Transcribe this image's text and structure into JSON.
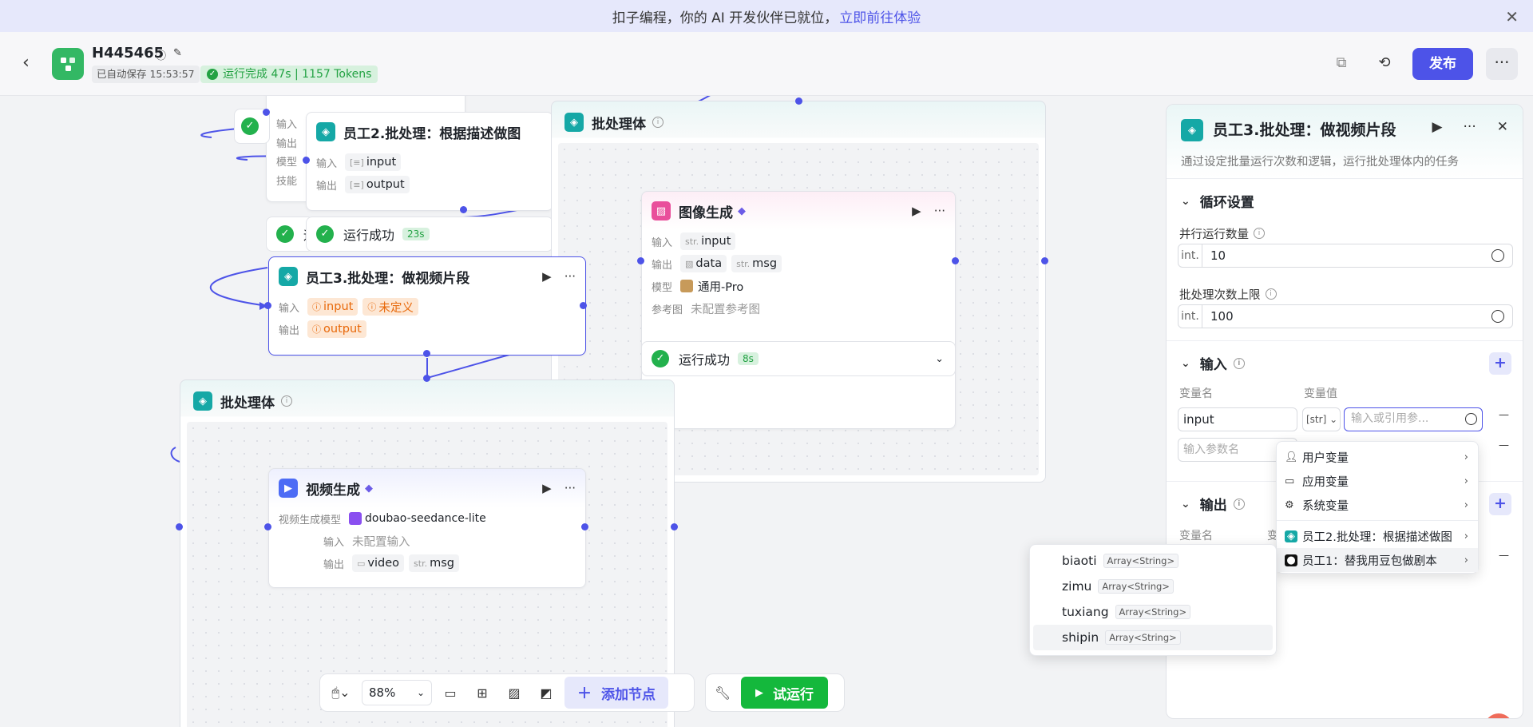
{
  "banner": {
    "text": "扣子编程，你的 AI 开发伙伴已就位，",
    "link": "立即前往体验",
    "close": "✕"
  },
  "header": {
    "back": "‹",
    "app_name": "H445465",
    "autosave": "已自动保存 15:53:57",
    "run_status": "运行完成 47s | 1157 Tokens",
    "publish": "发布",
    "more": "···"
  },
  "canvas": {
    "top_node_labels": [
      "输入",
      "输出",
      "模型",
      "技能"
    ],
    "employee2": {
      "title": "员工2.批处理：根据描述做图",
      "input_label": "输入",
      "input_val": "input",
      "output_label": "输出",
      "output_val": "output"
    },
    "status_23": {
      "text": "运行成功",
      "time": "23s"
    },
    "status_partial": "运",
    "employee3": {
      "title": "员工3.批处理：做视频片段",
      "input_label": "输入",
      "input_tags": [
        "input",
        "未定义"
      ],
      "output_label": "输出",
      "output_tag": "output"
    },
    "batch_top": {
      "title": "批处理体"
    },
    "image_gen": {
      "title": "图像生成",
      "input_label": "输入",
      "input_tag": "input",
      "output_label": "输出",
      "output_tags": [
        "data",
        "msg"
      ],
      "model_label": "模型",
      "model_val": "通用-Pro",
      "ref_label": "参考图",
      "ref_val": "未配置参考图"
    },
    "status_8": {
      "text": "运行成功",
      "time": "8s"
    },
    "batch_bottom": {
      "title": "批处理体"
    },
    "video_gen": {
      "title": "视频生成",
      "model_label": "视频生成模型",
      "model_val": "doubao-seedance-lite",
      "input_label": "输入",
      "input_val": "未配置输入",
      "output_label": "输出",
      "output_tags": [
        "video",
        "msg"
      ]
    }
  },
  "toolbar": {
    "zoom": "88%",
    "add_node": "添加节点",
    "try_run": "试运行"
  },
  "panel": {
    "title": "员工3.批处理：做视频片段",
    "desc": "通过设定批量运行次数和逻辑，运行批处理体内的任务",
    "loop_section": "循环设置",
    "parallel_label": "并行运行数量",
    "parallel_prefix": "int.",
    "parallel_value": "10",
    "limit_label": "批处理次数上限",
    "limit_prefix": "int.",
    "limit_value": "100",
    "input_section": "输入",
    "col_name": "变量名",
    "col_value": "变量值",
    "var_name": "input",
    "var_type": "[str]",
    "var_placeholder": "输入或引用参...",
    "param_placeholder": "输入参数名",
    "output_section": "输出",
    "out_col_name": "变量名",
    "out_col_value": "变",
    "minus": "—"
  },
  "ref_dropdown": {
    "items": [
      "用户变量",
      "应用变量",
      "系统变量",
      "员工2.批处理：根据描述做图",
      "员工1：替我用豆包做剧本"
    ]
  },
  "var_dropdown": {
    "items": [
      {
        "name": "biaoti",
        "type": "Array<String>"
      },
      {
        "name": "zimu",
        "type": "Array<String>"
      },
      {
        "name": "tuxiang",
        "type": "Array<String>"
      },
      {
        "name": "shipin",
        "type": "Array<String>"
      }
    ]
  },
  "colors": {
    "primary": "#4d53e8",
    "success": "#23b14d",
    "warn": "#e8690b",
    "teal": "#15a8a6"
  }
}
